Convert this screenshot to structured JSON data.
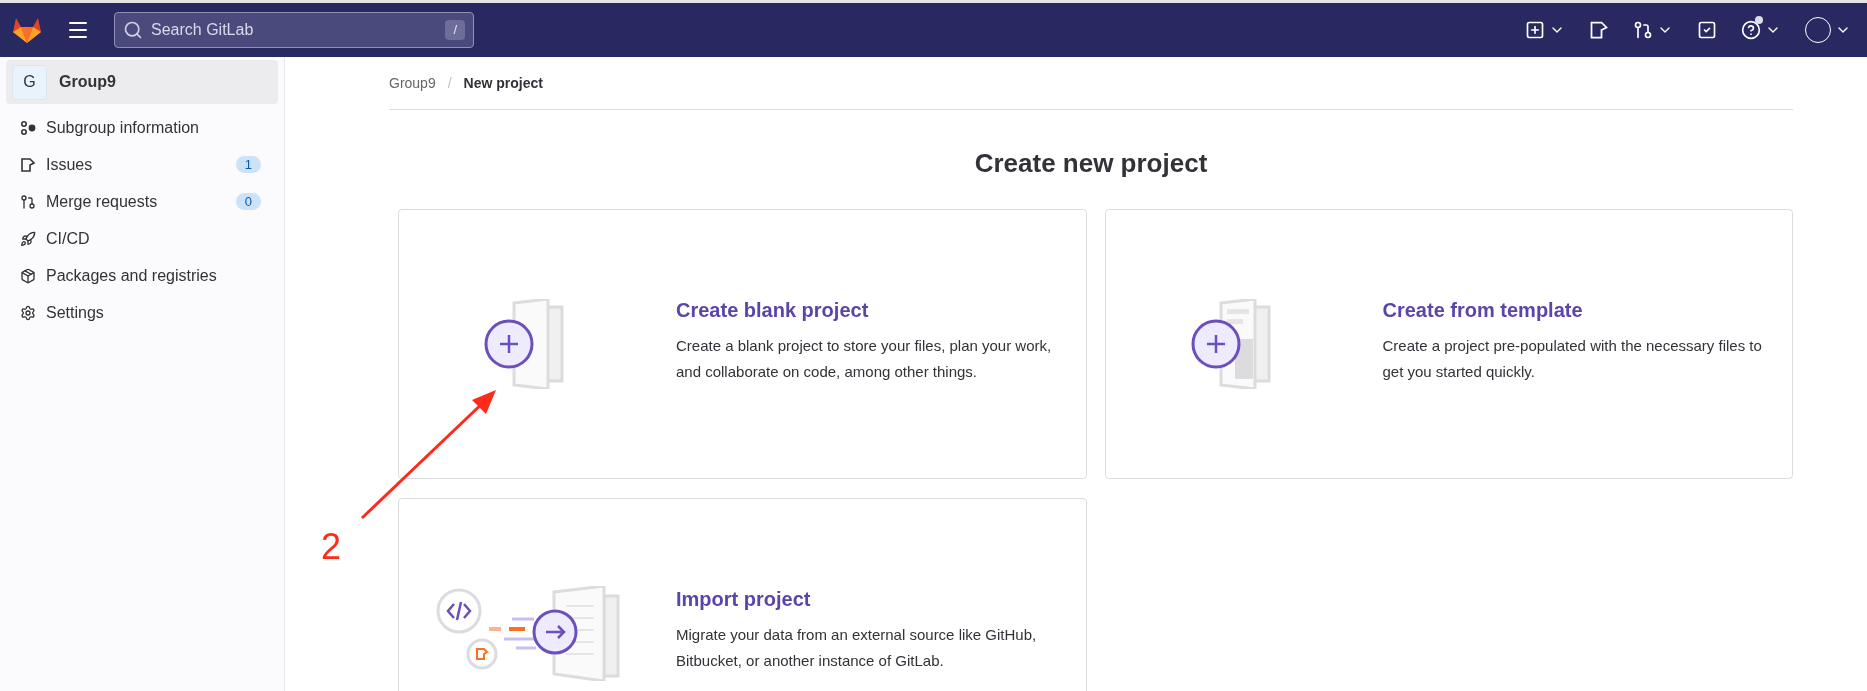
{
  "top_bar": {
    "search": {
      "placeholder": "Search GitLab",
      "shortcut": "/"
    },
    "help_notification": true
  },
  "sidebar": {
    "group": {
      "avatar": "G",
      "name": "Group9"
    },
    "items": [
      {
        "kind": "info",
        "label": "Subgroup information"
      },
      {
        "kind": "issues",
        "label": "Issues",
        "count": "1"
      },
      {
        "kind": "merge",
        "label": "Merge requests",
        "count": "0"
      },
      {
        "kind": "cicd",
        "label": "CI/CD"
      },
      {
        "kind": "packages",
        "label": "Packages and registries"
      },
      {
        "kind": "settings",
        "label": "Settings"
      }
    ]
  },
  "breadcrumb": {
    "separator": "/",
    "items": [
      {
        "label": "Group9"
      },
      {
        "label": "New project"
      }
    ]
  },
  "title": "Create new project",
  "cards": [
    {
      "kind": "blank",
      "title": "Create blank project",
      "description": "Create a blank project to store your files, plan your work, and collaborate on code, among other things."
    },
    {
      "kind": "template",
      "title": "Create from template",
      "description": "Create a project pre-populated with the necessary files to get you started quickly."
    },
    {
      "kind": "import",
      "title": "Import project",
      "description": "Migrate your data from an external source like GitHub, Bitbucket, or another instance of GitLab."
    }
  ],
  "annotation": {
    "label": "2"
  }
}
